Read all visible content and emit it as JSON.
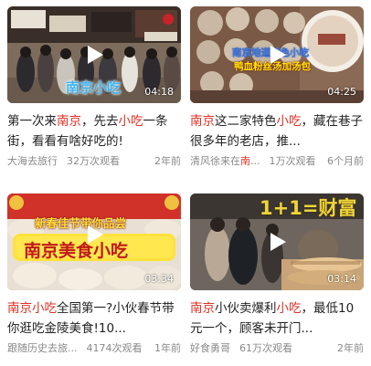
{
  "videos": [
    {
      "duration": "04:18",
      "title_parts": [
        {
          "text": "第一次来",
          "hl": false
        },
        {
          "text": "南京",
          "hl": true
        },
        {
          "text": "，先去",
          "hl": false
        },
        {
          "text": "小吃",
          "hl": true
        },
        {
          "text": "一条街，看看有啥好吃的!",
          "hl": false
        }
      ],
      "author": "大海去旅行",
      "views": "32万次观看",
      "age": "2年前",
      "overlay": "南京小吃",
      "shop_sign": "南京小吃"
    },
    {
      "duration": "04:25",
      "title_parts": [
        {
          "text": "南京",
          "hl": true
        },
        {
          "text": "这二家特色",
          "hl": false
        },
        {
          "text": "小吃",
          "hl": true
        },
        {
          "text": "，藏在巷子很多年的老店，推...",
          "hl": false
        }
      ],
      "author_parts": [
        {
          "text": "清风徐来在",
          "hl": false
        },
        {
          "text": "南",
          "hl": true
        },
        {
          "text": "...",
          "hl": false
        }
      ],
      "views": "1万次观看",
      "age": "6个月前",
      "overlay": "南京地道特色小吃",
      "overlay2": "鸭血粉丝汤加汤包"
    },
    {
      "duration": "03:34",
      "title_parts": [
        {
          "text": "南京",
          "hl": true
        },
        {
          "text": "小吃",
          "hl": true
        },
        {
          "text": "全国第一?小伙春节带你逛吃金陵美食!10...",
          "hl": false
        }
      ],
      "author": "跟随历史去旅...",
      "views": "4174次观看",
      "age": "1年前",
      "overlay": "新春佳节带你品尝",
      "overlay2": "南京美食小吃"
    },
    {
      "duration": "03:14",
      "title_parts": [
        {
          "text": "南京",
          "hl": true
        },
        {
          "text": "小伙卖爆利",
          "hl": false
        },
        {
          "text": "小吃",
          "hl": true
        },
        {
          "text": "，最低10元一个，顾客未开门...",
          "hl": false
        }
      ],
      "author": "好食勇哥",
      "views": "61万次观看",
      "age": "2年前",
      "overlay": "1+1=财富"
    }
  ],
  "colors": {
    "highlight": "#e02e24",
    "title": "#222222",
    "meta": "#888888"
  }
}
